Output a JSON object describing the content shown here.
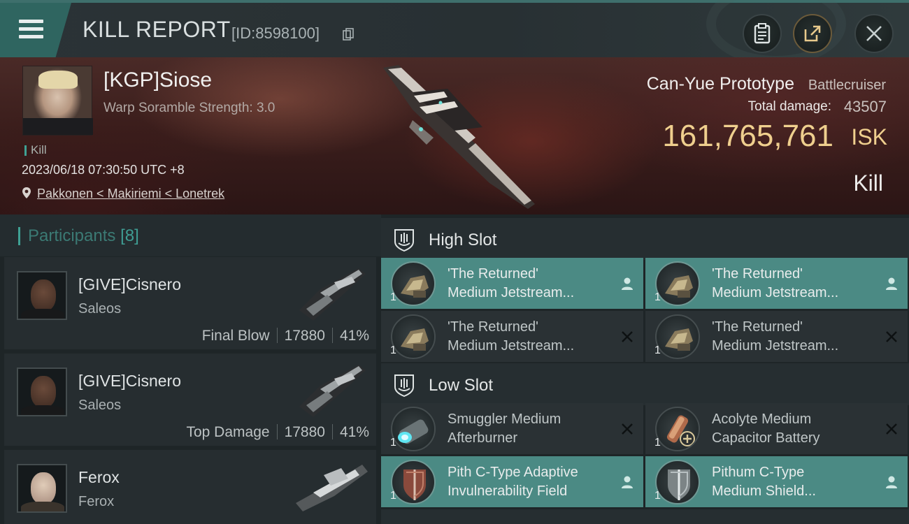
{
  "header": {
    "title": "KILL REPORT",
    "report_id": "[ID:8598100]"
  },
  "victim": {
    "name": "[KGP]Siose",
    "subtitle": "Warp Soramble Strength: 3.0",
    "tag": "Kill",
    "datetime": "2023/06/18 07:30:50 UTC +8",
    "location": "Pakkonen < Makiriemi < Lonetrek",
    "ship_name": "Can-Yue Prototype",
    "ship_class": "Battlecruiser",
    "total_damage_label": "Total damage:",
    "total_damage": "43507",
    "isk_value": "161,765,761",
    "isk_unit": "ISK",
    "result": "Kill"
  },
  "participants": {
    "label": "Participants",
    "count": "[8]",
    "rows": [
      {
        "name": "[GIVE]Cisnero",
        "ship": "Saleos",
        "role": "Final Blow",
        "damage": "17880",
        "percent": "41%"
      },
      {
        "name": "[GIVE]Cisnero",
        "ship": "Saleos",
        "role": "Top Damage",
        "damage": "17880",
        "percent": "41%"
      },
      {
        "name": "Ferox",
        "ship": "Ferox"
      }
    ]
  },
  "fitting": {
    "high_slot": {
      "title": "High Slot",
      "modules": [
        {
          "line1": "'The Returned'",
          "line2": "Medium Jetstream...",
          "qty": "1",
          "status": "person-icon"
        },
        {
          "line1": "'The Returned'",
          "line2": "Medium Jetstream...",
          "qty": "1",
          "status": "person-icon"
        },
        {
          "line1": "'The Returned'",
          "line2": "Medium Jetstream...",
          "qty": "1",
          "status": "destroyed-x-icon"
        },
        {
          "line1": "'The Returned'",
          "line2": "Medium Jetstream...",
          "qty": "1",
          "status": "destroyed-x-icon"
        }
      ]
    },
    "low_slot": {
      "title": "Low Slot",
      "modules": [
        {
          "line1": "Smuggler Medium",
          "line2": "Afterburner",
          "qty": "1",
          "status": "destroyed-x-icon"
        },
        {
          "line1": "Acolyte Medium",
          "line2": "Capacitor Battery",
          "qty": "1",
          "status": "destroyed-x-icon"
        },
        {
          "line1": "Pith C-Type Adaptive",
          "line2": "Invulnerability Field",
          "qty": "1",
          "status": "person-icon"
        },
        {
          "line1": "Pithum C-Type",
          "line2": "Medium Shield...",
          "qty": "1",
          "status": "person-icon"
        }
      ]
    }
  },
  "colors": {
    "accent": "#3fa194",
    "active_module": "#4b8a84",
    "isk": "#efcf8e"
  }
}
